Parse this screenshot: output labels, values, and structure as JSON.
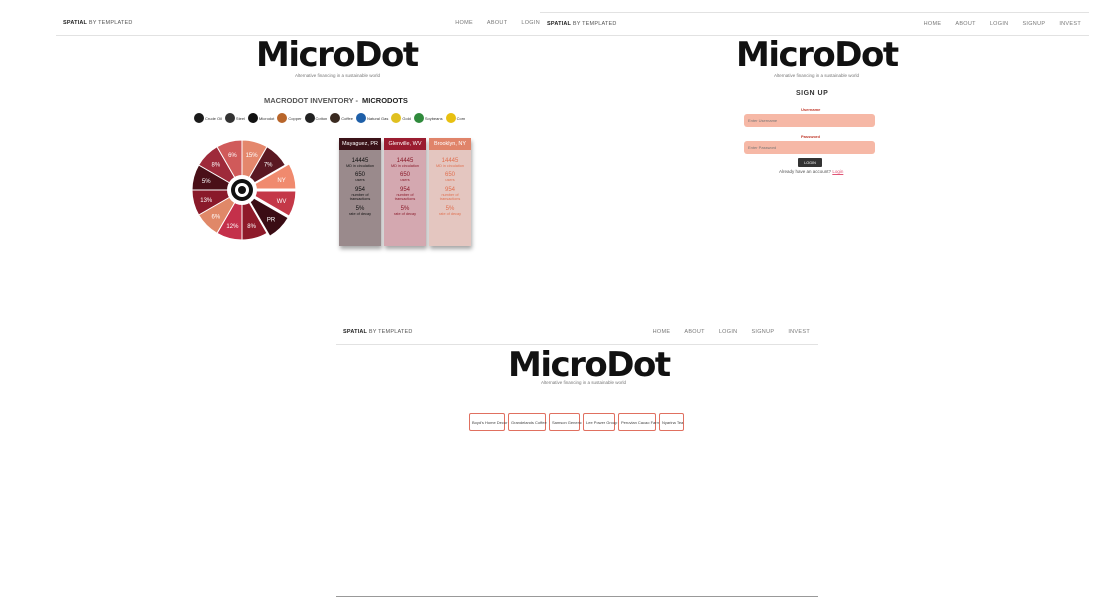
{
  "brand": {
    "strong": "SPATIAL",
    "rest": "BY TEMPLATED"
  },
  "logo": "MicroDot",
  "tagline": "Alternative financing in a sustainable world",
  "panel1": {
    "nav": [
      "HOME",
      "ABOUT",
      "LOGIN"
    ],
    "inventory_heading": "MACRODOT INVENTORY -",
    "inventory_heading_bold": "MICRODOTS",
    "legend": [
      {
        "label": "Crude Oil",
        "color": "#1a1a1a"
      },
      {
        "label": "Steel",
        "color": "#333333"
      },
      {
        "label": "Microdot",
        "color": "#111111"
      },
      {
        "label": "Copper",
        "color": "#b8652a"
      },
      {
        "label": "Cotton",
        "color": "#222222"
      },
      {
        "label": "Coffee",
        "color": "#3a2a20"
      },
      {
        "label": "Natural Gas",
        "color": "#1e5fa8"
      },
      {
        "label": "Gold",
        "color": "#e0c020"
      },
      {
        "label": "Soybeans",
        "color": "#2f8a3c"
      },
      {
        "label": "Corn",
        "color": "#e8c010"
      }
    ],
    "pie": {
      "labels": [
        "15%",
        "7%",
        "NY",
        "WV",
        "PR",
        "8%",
        "12%",
        "6%",
        "13%",
        "5%",
        "8%",
        "6%"
      ],
      "colors": [
        "#e4876c",
        "#5a1822",
        "#f08a6e",
        "#c43848",
        "#3a0c14",
        "#8e1a2a",
        "#c4304a",
        "#e08868",
        "#8a1a2a",
        "#4a1018",
        "#9e2a3a",
        "#d05a5a"
      ]
    },
    "cards": [
      {
        "city": "Mayaguez, PR",
        "head_color": "#3a1218",
        "body_color": "#9a8a8c",
        "text_color": "#111111",
        "dots": "14445",
        "dots_label": "MD in circulation",
        "users": "650",
        "users_label": "users",
        "tx": "954",
        "tx_label": "number of transactions",
        "decay": "5%",
        "decay_label": "rate of decay"
      },
      {
        "city": "Glenville, WV",
        "head_color": "#9a1c30",
        "body_color": "#d4a8b0",
        "text_color": "#8a1a2a",
        "dots": "14445",
        "dots_label": "MD in circulation",
        "users": "650",
        "users_label": "users",
        "tx": "954",
        "tx_label": "number of transactions",
        "decay": "5%",
        "decay_label": "rate of decay"
      },
      {
        "city": "Brooklyn, NY",
        "head_color": "#e0846a",
        "body_color": "#e4c6c0",
        "text_color": "#e07050",
        "dots": "14445",
        "dots_label": "MD in circulation",
        "users": "650",
        "users_label": "users",
        "tx": "954",
        "tx_label": "number of transactions",
        "decay": "5%",
        "decay_label": "rate of decay"
      }
    ]
  },
  "panel2": {
    "nav": [
      "HOME",
      "ABOUT",
      "LOGIN",
      "SIGNUP",
      "INVEST"
    ],
    "title": "SIGN UP",
    "username_label": "Username",
    "username_placeholder": "Enter Username",
    "password_label": "Password",
    "password_placeholder": "Enter Password",
    "login_button": "LOGIN",
    "already": "Already have an account?",
    "login_link": "Login"
  },
  "panel3": {
    "nav": [
      "HOME",
      "ABOUT",
      "LOGIN",
      "SIGNUP",
      "INVEST"
    ],
    "businesses": [
      "Boyd's Home Decor",
      "Grandelands Coffee",
      "Samson Generic",
      "Lee Power Group",
      "Peruvian Cacao Farm",
      "Nyarina Tea"
    ]
  }
}
